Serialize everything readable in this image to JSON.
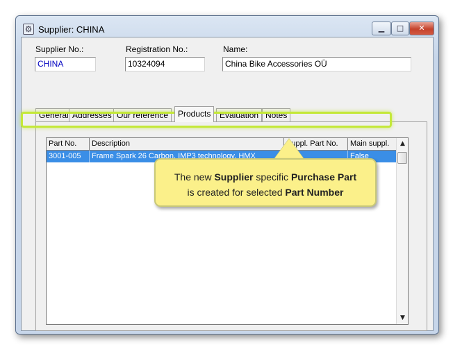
{
  "window": {
    "title": "Supplier: CHINA",
    "icon": "app-gear-icon",
    "controls": {
      "minimize": "minimize-icon",
      "maximize": "maximize-icon",
      "close": "close-icon"
    }
  },
  "header": {
    "supplier_no_label": "Supplier No.:",
    "supplier_no": "CHINA",
    "registration_no_label": "Registration No.:",
    "registration_no": "10324094",
    "name_label": "Name:",
    "name": "China Bike Accessories OÜ"
  },
  "tabs": [
    {
      "label": "General"
    },
    {
      "label": "Addresses"
    },
    {
      "label": "Our reference"
    },
    {
      "label": "Products"
    },
    {
      "label": "Evaluation"
    },
    {
      "label": "Notes"
    }
  ],
  "active_tab": "Products",
  "grid": {
    "columns": [
      "Part No.",
      "Description",
      "Suppl. Part No.",
      "Main suppl."
    ],
    "rows": [
      {
        "part_no": "3001-005",
        "description": "Frame Spark 26 Carbon, IMP3 technology, HMX",
        "suppl_part_no": "",
        "main_suppl": "False"
      }
    ]
  },
  "callout": {
    "line1_a": "The new ",
    "line1_b": "Supplier",
    "line1_c": " specific ",
    "line1_d": "Purchase Part",
    "line2_a": "is created for selected ",
    "line2_b": "Part Number"
  },
  "colors": {
    "selection": "#3a8ee6",
    "highlight": "#c4e83a",
    "callout": "#fbf08a"
  }
}
